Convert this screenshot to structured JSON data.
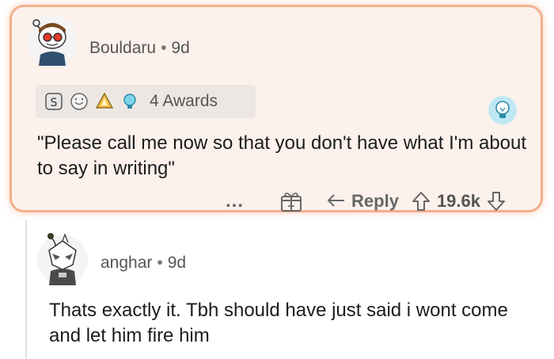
{
  "comment": {
    "author": "Bouldaru",
    "separator": "•",
    "age": "9d",
    "awards_label": "4 Awards",
    "award_icons": [
      "silver-award-icon",
      "wholesome-award-icon",
      "rocket-award-icon",
      "helpful-award-icon"
    ],
    "body": "\"Please call me now so that you don't have what I'm about to say in writing\"",
    "more_label": "...",
    "reply_label": "Reply",
    "score": "19.6k",
    "accent_border": "#f3b08e",
    "card_bg": "#fdf1ec"
  },
  "reply": {
    "author": "anghar",
    "separator": "•",
    "age": "9d",
    "body": "Thats exactly it. Tbh should have just said i wont come and let him fire him"
  }
}
